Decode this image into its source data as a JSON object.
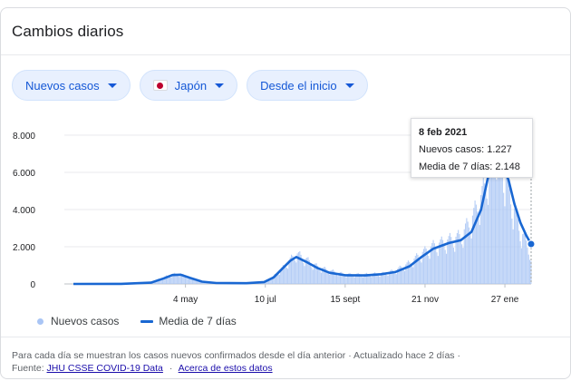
{
  "card": {
    "title": "Cambios diarios"
  },
  "filters": [
    {
      "label": "Nuevos casos",
      "flag": false
    },
    {
      "label": "Japón",
      "flag": true
    },
    {
      "label": "Desde el inicio",
      "flag": false
    }
  ],
  "chart_data": {
    "type": "bar",
    "ylim": [
      0,
      8000
    ],
    "yticks": [
      0,
      2000,
      4000,
      6000,
      8000
    ],
    "ytick_labels": [
      "0",
      "2.000",
      "4.000",
      "6.000",
      "8.000"
    ],
    "xtick_labels": [
      "4 may",
      "10 jul",
      "15 sept",
      "21 nov",
      "27 ene"
    ],
    "xtick_days": [
      94,
      161,
      228,
      295,
      362
    ],
    "date_range": [
      "2020-01-22",
      "2021-02-08"
    ],
    "series": [
      {
        "name": "Nuevos casos",
        "kind": "daily-bars",
        "color": "#a9c5f5",
        "anchors": [
          [
            0,
            0
          ],
          [
            40,
            5
          ],
          [
            65,
            100
          ],
          [
            76,
            350
          ],
          [
            83,
            500
          ],
          [
            89,
            520
          ],
          [
            96,
            380
          ],
          [
            105,
            150
          ],
          [
            120,
            50
          ],
          [
            140,
            40
          ],
          [
            160,
            120
          ],
          [
            168,
            400
          ],
          [
            175,
            800
          ],
          [
            181,
            1200
          ],
          [
            187,
            1600
          ],
          [
            195,
            1300
          ],
          [
            205,
            900
          ],
          [
            215,
            700
          ],
          [
            228,
            500
          ],
          [
            245,
            500
          ],
          [
            260,
            550
          ],
          [
            270,
            700
          ],
          [
            282,
            1100
          ],
          [
            292,
            1600
          ],
          [
            302,
            2000
          ],
          [
            315,
            2300
          ],
          [
            325,
            2500
          ],
          [
            335,
            3500
          ],
          [
            345,
            5000
          ],
          [
            350,
            6500
          ],
          [
            355,
            7800
          ],
          [
            358,
            6500
          ],
          [
            362,
            5800
          ],
          [
            367,
            4500
          ],
          [
            375,
            2800
          ],
          [
            383,
            1800
          ],
          [
            384,
            1227
          ]
        ]
      },
      {
        "name": "Media de 7 días",
        "kind": "line",
        "color": "#1967d2",
        "points": [
          [
            0,
            0
          ],
          [
            40,
            5
          ],
          [
            65,
            70
          ],
          [
            76,
            300
          ],
          [
            83,
            480
          ],
          [
            90,
            500
          ],
          [
            98,
            320
          ],
          [
            108,
            120
          ],
          [
            120,
            50
          ],
          [
            145,
            40
          ],
          [
            160,
            100
          ],
          [
            168,
            350
          ],
          [
            175,
            800
          ],
          [
            182,
            1250
          ],
          [
            187,
            1450
          ],
          [
            195,
            1200
          ],
          [
            205,
            850
          ],
          [
            215,
            600
          ],
          [
            228,
            470
          ],
          [
            245,
            460
          ],
          [
            258,
            520
          ],
          [
            270,
            640
          ],
          [
            282,
            950
          ],
          [
            292,
            1450
          ],
          [
            302,
            1900
          ],
          [
            315,
            2200
          ],
          [
            325,
            2350
          ],
          [
            334,
            2800
          ],
          [
            342,
            4000
          ],
          [
            348,
            5800
          ],
          [
            352,
            6500
          ],
          [
            356,
            6900
          ],
          [
            360,
            6400
          ],
          [
            365,
            5600
          ],
          [
            370,
            4300
          ],
          [
            375,
            3300
          ],
          [
            380,
            2600
          ],
          [
            384,
            2148
          ]
        ]
      }
    ]
  },
  "tooltip": {
    "date": "8 feb 2021",
    "new_cases": "Nuevos casos: 1.227",
    "avg": "Media de 7 días: 2.148"
  },
  "legend": {
    "cases": "Nuevos casos",
    "avg": "Media de 7 días"
  },
  "footer": {
    "line1": "Para cada día se muestran los casos nuevos confirmados desde el día anterior · Actualizado hace 2 días ·",
    "source_prefix": "Fuente:",
    "source_link": "JHU CSSE COVID-19 Data",
    "sep": "·",
    "about_link": "Acerca de estos datos"
  }
}
